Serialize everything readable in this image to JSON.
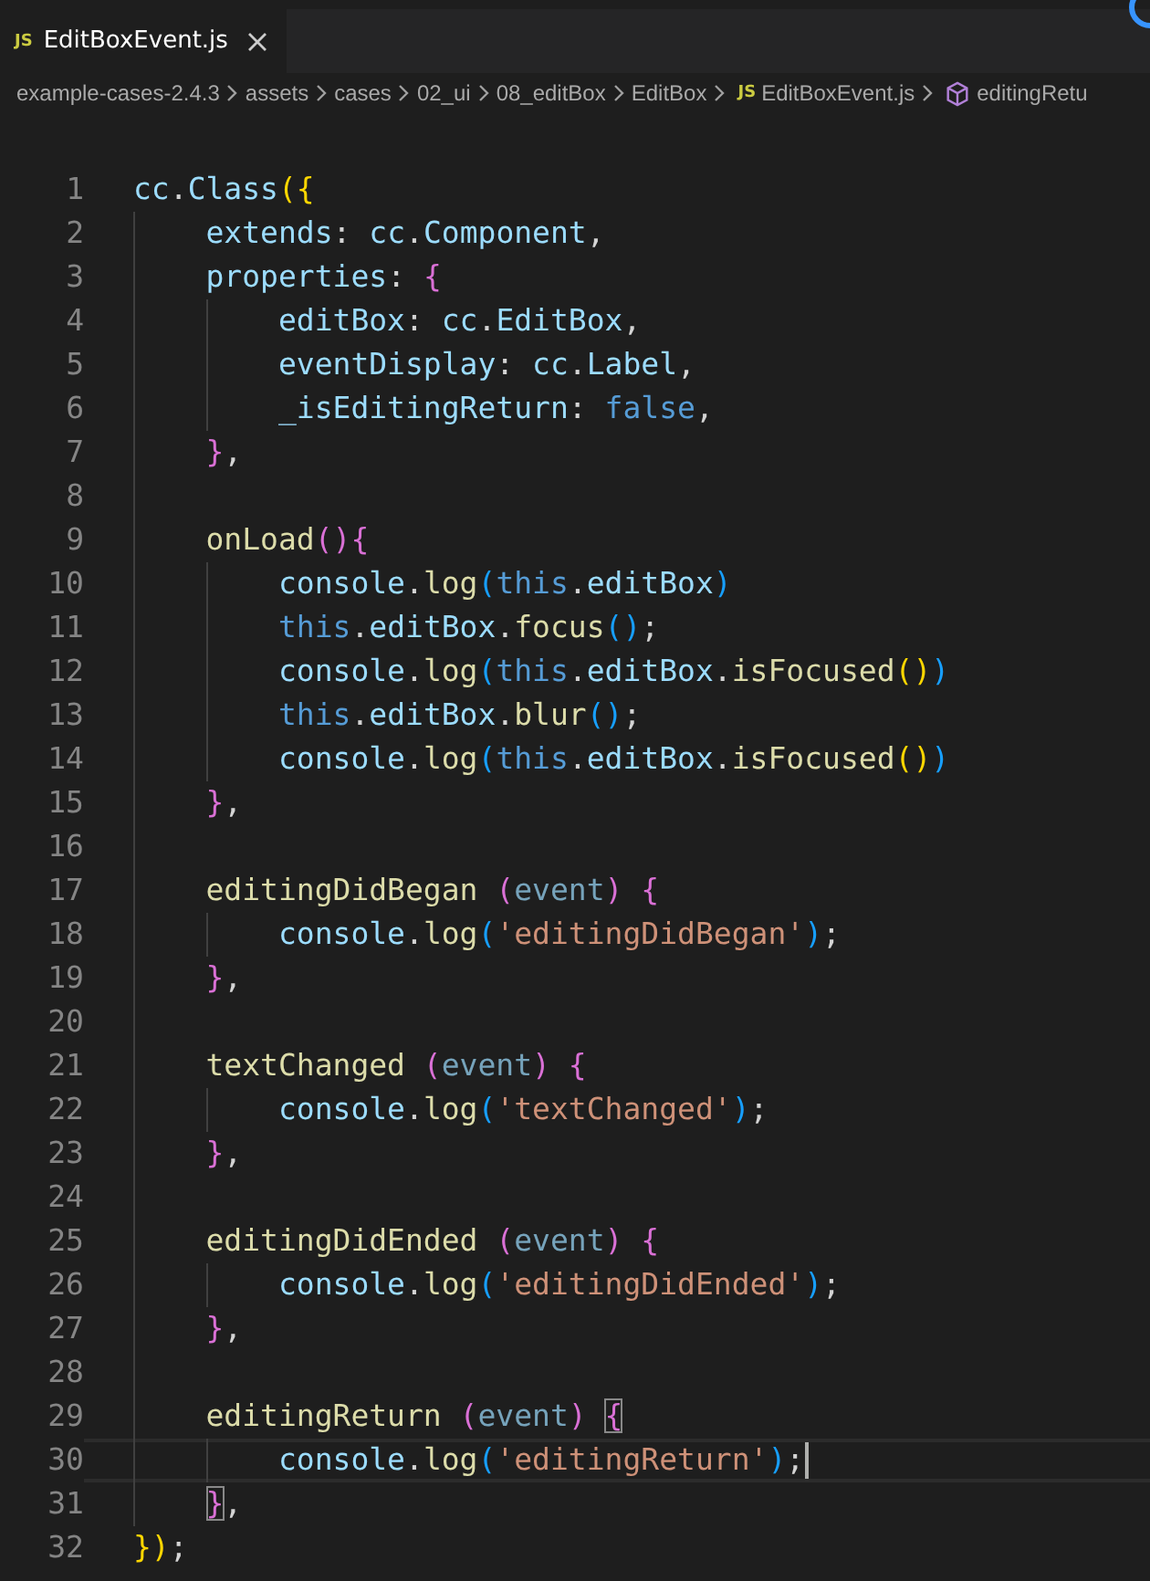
{
  "tabs": [
    {
      "icon": "JS",
      "label": "EditBoxEvent.js",
      "selected": true
    }
  ],
  "breadcrumb": [
    {
      "kind": "folder",
      "label": "example-cases-2.4.3"
    },
    {
      "kind": "folder",
      "label": "assets"
    },
    {
      "kind": "folder",
      "label": "cases"
    },
    {
      "kind": "folder",
      "label": "02_ui"
    },
    {
      "kind": "folder",
      "label": "08_editBox"
    },
    {
      "kind": "folder",
      "label": "EditBox"
    },
    {
      "kind": "file",
      "icon": "JS",
      "label": "EditBoxEvent.js"
    },
    {
      "kind": "symbol",
      "label": "editingRetu"
    }
  ],
  "lines": [
    {
      "number": "1",
      "current": false,
      "tokens": [
        {
          "kind": "var",
          "t": "cc"
        },
        {
          "kind": "plain",
          "t": "."
        },
        {
          "kind": "var",
          "t": "Class"
        },
        {
          "kind": "bracket",
          "t": "({"
        }
      ]
    },
    {
      "number": "2",
      "current": false,
      "tokens": [
        {
          "kind": "var",
          "t": "extends"
        },
        {
          "kind": "plain",
          "t": ": "
        },
        {
          "kind": "var",
          "t": "cc"
        },
        {
          "kind": "plain",
          "t": "."
        },
        {
          "kind": "var",
          "t": "Component"
        },
        {
          "kind": "plain",
          "t": ","
        }
      ]
    },
    {
      "number": "3",
      "current": false,
      "tokens": [
        {
          "kind": "var",
          "t": "properties"
        },
        {
          "kind": "plain",
          "t": ": "
        },
        {
          "kind": "bracket2",
          "t": "{"
        }
      ]
    },
    {
      "number": "4",
      "current": false,
      "tokens": [
        {
          "kind": "var",
          "t": "editBox"
        },
        {
          "kind": "plain",
          "t": ": "
        },
        {
          "kind": "var",
          "t": "cc"
        },
        {
          "kind": "plain",
          "t": "."
        },
        {
          "kind": "var",
          "t": "EditBox"
        },
        {
          "kind": "plain",
          "t": ","
        }
      ]
    },
    {
      "number": "5",
      "current": false,
      "tokens": [
        {
          "kind": "var",
          "t": "eventDisplay"
        },
        {
          "kind": "plain",
          "t": ": "
        },
        {
          "kind": "var",
          "t": "cc"
        },
        {
          "kind": "plain",
          "t": "."
        },
        {
          "kind": "var",
          "t": "Label"
        },
        {
          "kind": "plain",
          "t": ","
        }
      ]
    },
    {
      "number": "6",
      "current": false,
      "tokens": [
        {
          "kind": "var",
          "t": "_isEditingReturn"
        },
        {
          "kind": "plain",
          "t": ": "
        },
        {
          "kind": "keyword",
          "t": "false"
        },
        {
          "kind": "plain",
          "t": ","
        }
      ]
    },
    {
      "number": "7",
      "current": false,
      "tokens": [
        {
          "kind": "bracket2",
          "t": "}"
        },
        {
          "kind": "plain",
          "t": ","
        }
      ]
    },
    {
      "number": "8",
      "current": false
    },
    {
      "number": "9",
      "current": false,
      "tokens": [
        {
          "kind": "func",
          "t": "onLoad"
        },
        {
          "kind": "bracket2",
          "t": "(){"
        }
      ]
    },
    {
      "number": "10",
      "current": false,
      "tokens": [
        {
          "kind": "var",
          "t": "console"
        },
        {
          "kind": "plain",
          "t": "."
        },
        {
          "kind": "func",
          "t": "log"
        },
        {
          "kind": "bracket3",
          "t": "("
        },
        {
          "kind": "keyword",
          "t": "this"
        },
        {
          "kind": "plain",
          "t": "."
        },
        {
          "kind": "var",
          "t": "editBox"
        },
        {
          "kind": "bracket3",
          "t": ")"
        }
      ]
    },
    {
      "number": "11",
      "current": false,
      "tokens": [
        {
          "kind": "keyword",
          "t": "this"
        },
        {
          "kind": "plain",
          "t": "."
        },
        {
          "kind": "var",
          "t": "editBox"
        },
        {
          "kind": "plain",
          "t": "."
        },
        {
          "kind": "func",
          "t": "focus"
        },
        {
          "kind": "bracket3",
          "t": "()"
        },
        {
          "kind": "plain",
          "t": ";"
        }
      ]
    },
    {
      "number": "12",
      "current": false,
      "tokens": [
        {
          "kind": "var",
          "t": "console"
        },
        {
          "kind": "plain",
          "t": "."
        },
        {
          "kind": "func",
          "t": "log"
        },
        {
          "kind": "bracket3",
          "t": "("
        },
        {
          "kind": "keyword",
          "t": "this"
        },
        {
          "kind": "plain",
          "t": "."
        },
        {
          "kind": "var",
          "t": "editBox"
        },
        {
          "kind": "plain",
          "t": "."
        },
        {
          "kind": "func",
          "t": "isFocused"
        },
        {
          "kind": "bracket",
          "t": "()"
        },
        {
          "kind": "bracket3",
          "t": ")"
        }
      ]
    },
    {
      "number": "13",
      "current": false,
      "tokens": [
        {
          "kind": "keyword",
          "t": "this"
        },
        {
          "kind": "plain",
          "t": "."
        },
        {
          "kind": "var",
          "t": "editBox"
        },
        {
          "kind": "plain",
          "t": "."
        },
        {
          "kind": "func",
          "t": "blur"
        },
        {
          "kind": "bracket3",
          "t": "()"
        },
        {
          "kind": "plain",
          "t": ";"
        }
      ]
    },
    {
      "number": "14",
      "current": false,
      "tokens": [
        {
          "kind": "var",
          "t": "console"
        },
        {
          "kind": "plain",
          "t": "."
        },
        {
          "kind": "func",
          "t": "log"
        },
        {
          "kind": "bracket3",
          "t": "("
        },
        {
          "kind": "keyword",
          "t": "this"
        },
        {
          "kind": "plain",
          "t": "."
        },
        {
          "kind": "var",
          "t": "editBox"
        },
        {
          "kind": "plain",
          "t": "."
        },
        {
          "kind": "func",
          "t": "isFocused"
        },
        {
          "kind": "bracket",
          "t": "()"
        },
        {
          "kind": "bracket3",
          "t": ")"
        }
      ]
    },
    {
      "number": "15",
      "current": false,
      "tokens": [
        {
          "kind": "bracket2",
          "t": "}"
        },
        {
          "kind": "plain",
          "t": ","
        }
      ]
    },
    {
      "number": "16",
      "current": false
    },
    {
      "number": "17",
      "current": false,
      "tokens": [
        {
          "kind": "func",
          "t": "editingDidBegan"
        },
        {
          "kind": "bracket2",
          "t": " ("
        },
        {
          "kind": "param",
          "t": "event"
        },
        {
          "kind": "bracket2",
          "t": ")"
        },
        {
          "kind": "bracket2",
          "t": " {"
        }
      ]
    },
    {
      "number": "18",
      "current": false,
      "tokens": [
        {
          "kind": "var",
          "t": "console"
        },
        {
          "kind": "plain",
          "t": "."
        },
        {
          "kind": "func",
          "t": "log"
        },
        {
          "kind": "bracket3",
          "t": "("
        },
        {
          "kind": "string",
          "t": "'editingDidBegan'"
        },
        {
          "kind": "bracket3",
          "t": ")"
        },
        {
          "kind": "plain",
          "t": ";"
        }
      ]
    },
    {
      "number": "19",
      "current": false,
      "tokens": [
        {
          "kind": "bracket2",
          "t": "}"
        },
        {
          "kind": "plain",
          "t": ","
        }
      ]
    },
    {
      "number": "20",
      "current": false
    },
    {
      "number": "21",
      "current": false,
      "tokens": [
        {
          "kind": "func",
          "t": "textChanged"
        },
        {
          "kind": "bracket2",
          "t": " ("
        },
        {
          "kind": "param",
          "t": "event"
        },
        {
          "kind": "bracket2",
          "t": ")"
        },
        {
          "kind": "bracket2",
          "t": " {"
        }
      ]
    },
    {
      "number": "22",
      "current": false,
      "tokens": [
        {
          "kind": "var",
          "t": "console"
        },
        {
          "kind": "plain",
          "t": "."
        },
        {
          "kind": "func",
          "t": "log"
        },
        {
          "kind": "bracket3",
          "t": "("
        },
        {
          "kind": "string",
          "t": "'textChanged'"
        },
        {
          "kind": "bracket3",
          "t": ")"
        },
        {
          "kind": "plain",
          "t": ";"
        }
      ]
    },
    {
      "number": "23",
      "current": false,
      "tokens": [
        {
          "kind": "bracket2",
          "t": "}"
        },
        {
          "kind": "plain",
          "t": ","
        }
      ]
    },
    {
      "number": "24",
      "current": false
    },
    {
      "number": "25",
      "current": false,
      "tokens": [
        {
          "kind": "func",
          "t": "editingDidEnded"
        },
        {
          "kind": "bracket2",
          "t": " ("
        },
        {
          "kind": "param",
          "t": "event"
        },
        {
          "kind": "bracket2",
          "t": ")"
        },
        {
          "kind": "bracket2",
          "t": " {"
        }
      ]
    },
    {
      "number": "26",
      "current": false,
      "tokens": [
        {
          "kind": "var",
          "t": "console"
        },
        {
          "kind": "plain",
          "t": "."
        },
        {
          "kind": "func",
          "t": "log"
        },
        {
          "kind": "bracket3",
          "t": "("
        },
        {
          "kind": "string",
          "t": "'editingDidEnded'"
        },
        {
          "kind": "bracket3",
          "t": ")"
        },
        {
          "kind": "plain",
          "t": ";"
        }
      ]
    },
    {
      "number": "27",
      "current": false,
      "tokens": [
        {
          "kind": "bracket2",
          "t": "}"
        },
        {
          "kind": "plain",
          "t": ","
        }
      ]
    },
    {
      "number": "28",
      "current": false
    },
    {
      "number": "29",
      "current": false,
      "tokens": [
        {
          "kind": "func",
          "t": "editingReturn"
        },
        {
          "kind": "bracket2",
          "t": " ("
        },
        {
          "kind": "param",
          "t": "event"
        },
        {
          "kind": "bracket2",
          "t": ")"
        },
        {
          "kind": "spacer-match",
          "t": "{"
        }
      ]
    },
    {
      "number": "30",
      "current": true,
      "tokens": [
        {
          "kind": "var",
          "t": "console"
        },
        {
          "kind": "plain",
          "t": "."
        },
        {
          "kind": "func",
          "t": "log"
        },
        {
          "kind": "bracket3",
          "t": "("
        },
        {
          "kind": "string",
          "t": "'editingReturn'"
        },
        {
          "kind": "bracket3",
          "t": ")"
        },
        {
          "kind": "plain",
          "t": ";"
        }
      ]
    },
    {
      "number": "31",
      "current": false,
      "tokens": [
        {
          "kind": "match",
          "t": "}"
        },
        {
          "kind": "plain",
          "t": ","
        }
      ]
    },
    {
      "number": "32",
      "current": false,
      "tokens": [
        {
          "kind": "bracket",
          "t": "})"
        },
        {
          "kind": "plain",
          "t": ";"
        }
      ]
    }
  ]
}
